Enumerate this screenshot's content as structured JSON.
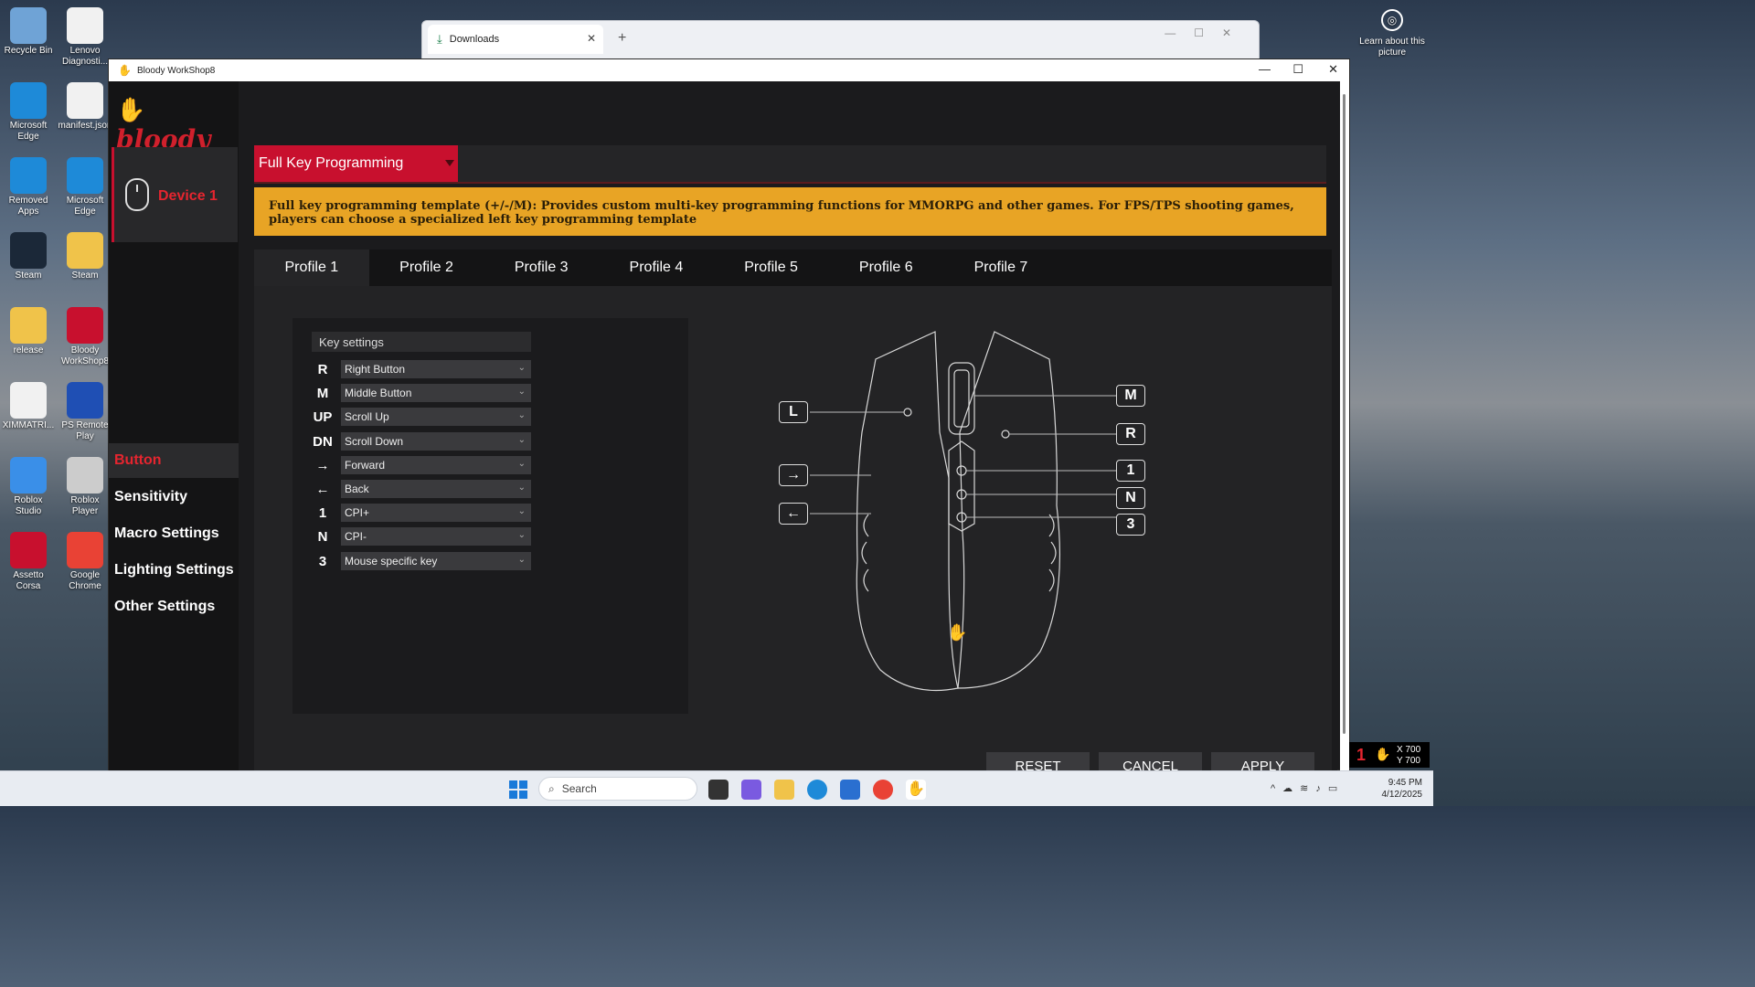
{
  "desktop": {
    "icons": [
      {
        "label": "Recycle Bin",
        "color": "#6fa3d6"
      },
      {
        "label": "Lenovo Diagnosti...",
        "color": "#f1f1f1"
      },
      {
        "label": "Microsoft Edge",
        "color": "#1e8ad8"
      },
      {
        "label": "manifest.json",
        "color": "#f1f1f1"
      },
      {
        "label": "Removed Apps",
        "color": "#1e8ad8"
      },
      {
        "label": "Microsoft Edge",
        "color": "#1e8ad8"
      },
      {
        "label": "Steam",
        "color": "#1b2838"
      },
      {
        "label": "Steam",
        "color": "#f0c34a"
      },
      {
        "label": "release",
        "color": "#f0c34a"
      },
      {
        "label": "Bloody WorkShop8",
        "color": "#c8102e"
      },
      {
        "label": "XIMMATRI...",
        "color": "#f1f1f1"
      },
      {
        "label": "PS Remote Play",
        "color": "#1f4fb4"
      },
      {
        "label": "Roblox Studio",
        "color": "#3a8fe8"
      },
      {
        "label": "Roblox Player",
        "color": "#cccccc"
      },
      {
        "label": "Assetto Corsa",
        "color": "#c8102e"
      },
      {
        "label": "Google Chrome",
        "color": "#e94235"
      }
    ],
    "learn_about": "Learn about this picture"
  },
  "downloads_window": {
    "tab_label": "Downloads",
    "close": "✕",
    "new_tab": "+"
  },
  "app": {
    "title": "Bloody WorkShop8",
    "brand": "bloody",
    "device_label": "Device 1",
    "menu": [
      {
        "label": "Button",
        "active": true
      },
      {
        "label": "Sensitivity",
        "active": false
      },
      {
        "label": "Macro Settings",
        "active": false
      },
      {
        "label": "Lighting Settings",
        "active": false
      },
      {
        "label": "Other Settings",
        "active": false
      }
    ],
    "mode": "Full Key Programming",
    "notice": "Full key programming template (+/-/M): Provides custom multi-key programming functions for MMORPG and other games.  For FPS/TPS shooting games, players can choose a specialized left key programming template",
    "profiles": [
      "Profile 1",
      "Profile 2",
      "Profile 3",
      "Profile 4",
      "Profile 5",
      "Profile 6",
      "Profile 7"
    ],
    "key_settings": {
      "header": "Key settings",
      "rows": [
        {
          "key": "R",
          "value": "Right Button"
        },
        {
          "key": "M",
          "value": "Middle Button"
        },
        {
          "key": "UP",
          "value": "Scroll Up"
        },
        {
          "key": "DN",
          "value": "Scroll Down"
        },
        {
          "key": "→",
          "value": "Forward"
        },
        {
          "key": "←",
          "value": "Back"
        },
        {
          "key": "1",
          "value": "CPI+"
        },
        {
          "key": "N",
          "value": "CPI-"
        },
        {
          "key": "3",
          "value": "Mouse specific key"
        }
      ]
    },
    "mouse_callouts": [
      "L",
      "M",
      "R",
      "→",
      "1",
      "N",
      "←",
      "3"
    ],
    "buttons": {
      "reset": "RESET",
      "cancel": "CANCEL",
      "apply": "APPLY"
    }
  },
  "taskbar": {
    "search_placeholder": "Search",
    "time": "9:45 PM",
    "date": "4/12/2025"
  },
  "corner_widget": {
    "x": "X 700",
    "y": "Y 700",
    "badge": "1"
  }
}
